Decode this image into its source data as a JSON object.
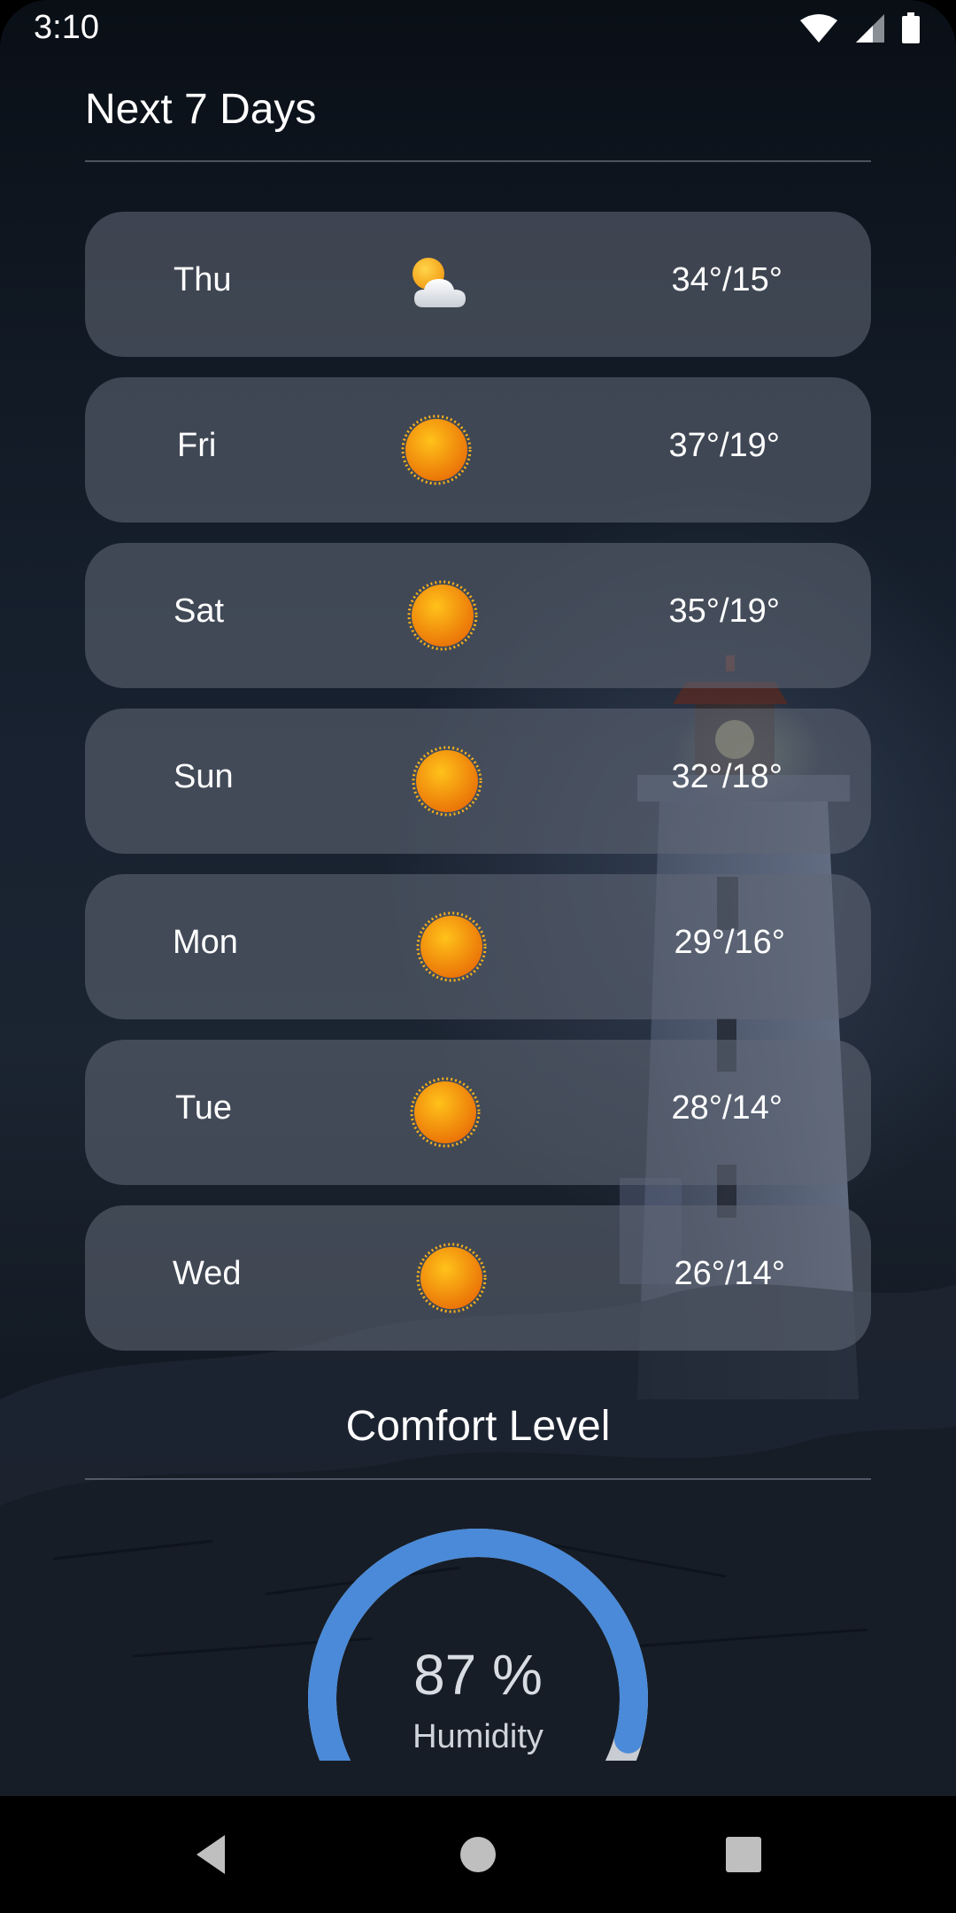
{
  "status_bar": {
    "time": "3:10",
    "icons": [
      "wifi-icon",
      "cellular-signal-icon",
      "battery-icon"
    ]
  },
  "forecast": {
    "title": "Next 7 Days",
    "days": [
      {
        "day": "Thu",
        "icon": "partly-cloudy-icon",
        "temps": "34°/15°"
      },
      {
        "day": "Fri",
        "icon": "sunny-icon",
        "temps": "37°/19°"
      },
      {
        "day": "Sat",
        "icon": "sunny-icon",
        "temps": "35°/19°"
      },
      {
        "day": "Sun",
        "icon": "sunny-icon",
        "temps": "32°/18°"
      },
      {
        "day": "Mon",
        "icon": "sunny-icon",
        "temps": "29°/16°"
      },
      {
        "day": "Tue",
        "icon": "sunny-icon",
        "temps": "28°/14°"
      },
      {
        "day": "Wed",
        "icon": "sunny-icon",
        "temps": "26°/14°"
      }
    ]
  },
  "comfort": {
    "title": "Comfort Level",
    "humidity_value": "87 %",
    "humidity_label": "Humidity",
    "humidity_fraction": 0.87,
    "gauge_color": "#4a8ad8",
    "gauge_track_color": "#c9ccd3"
  },
  "nav": {
    "buttons": [
      "back-icon",
      "home-icon",
      "recents-icon"
    ]
  }
}
